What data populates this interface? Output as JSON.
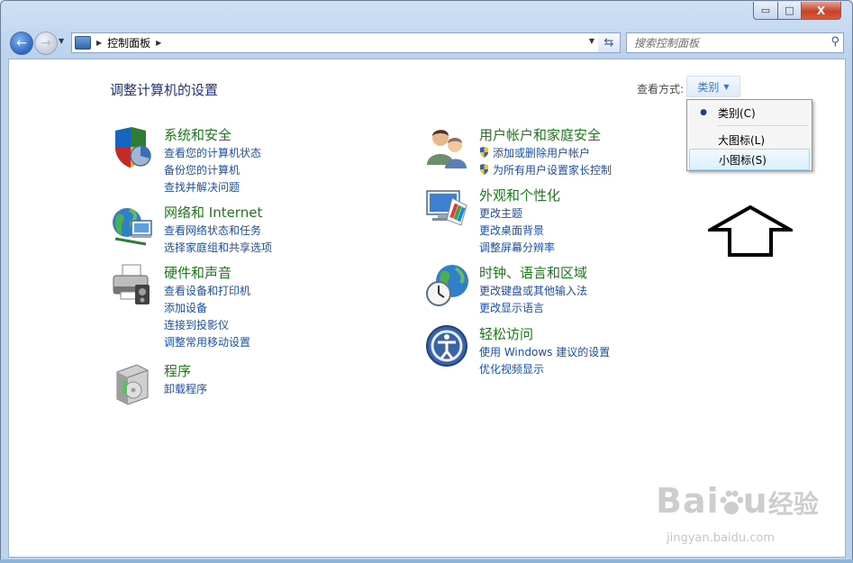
{
  "window": {
    "minimize": "▭",
    "maximize": "□",
    "close": "X"
  },
  "nav": {
    "address": "控制面板",
    "search_placeholder": "搜索控制面板"
  },
  "header": {
    "title": "调整计算机的设置",
    "view_label": "查看方式:",
    "view_value": "类别"
  },
  "view_menu": {
    "items": [
      {
        "label": "类别(C)",
        "selected": true
      },
      {
        "label": "大图标(L)",
        "selected": false
      },
      {
        "label": "小图标(S)",
        "selected": false,
        "hover": true
      }
    ]
  },
  "categories": [
    {
      "title": "系统和安全",
      "links": [
        "查看您的计算机状态",
        "备份您的计算机",
        "查找并解决问题"
      ]
    },
    {
      "title": "网络和 Internet",
      "links": [
        "查看网络状态和任务",
        "选择家庭组和共享选项"
      ]
    },
    {
      "title": "硬件和声音",
      "links": [
        "查看设备和打印机",
        "添加设备",
        "连接到投影仪",
        "调整常用移动设置"
      ]
    },
    {
      "title": "程序",
      "links": [
        "卸载程序"
      ]
    },
    {
      "title": "用户帐户和家庭安全",
      "links": [
        "添加或删除用户帐户",
        "为所有用户设置家长控制"
      ]
    },
    {
      "title": "外观和个性化",
      "links": [
        "更改主题",
        "更改桌面背景",
        "调整屏幕分辨率"
      ]
    },
    {
      "title": "时钟、语言和区域",
      "links": [
        "更改键盘或其他输入法",
        "更改显示语言"
      ]
    },
    {
      "title": "轻松访问",
      "links": [
        "使用 Windows 建议的设置",
        "优化视频显示"
      ]
    }
  ],
  "watermark": {
    "brand": "Bai",
    "brand_end": "u",
    "cn": "经验",
    "url": "jingyan.baidu.com"
  }
}
